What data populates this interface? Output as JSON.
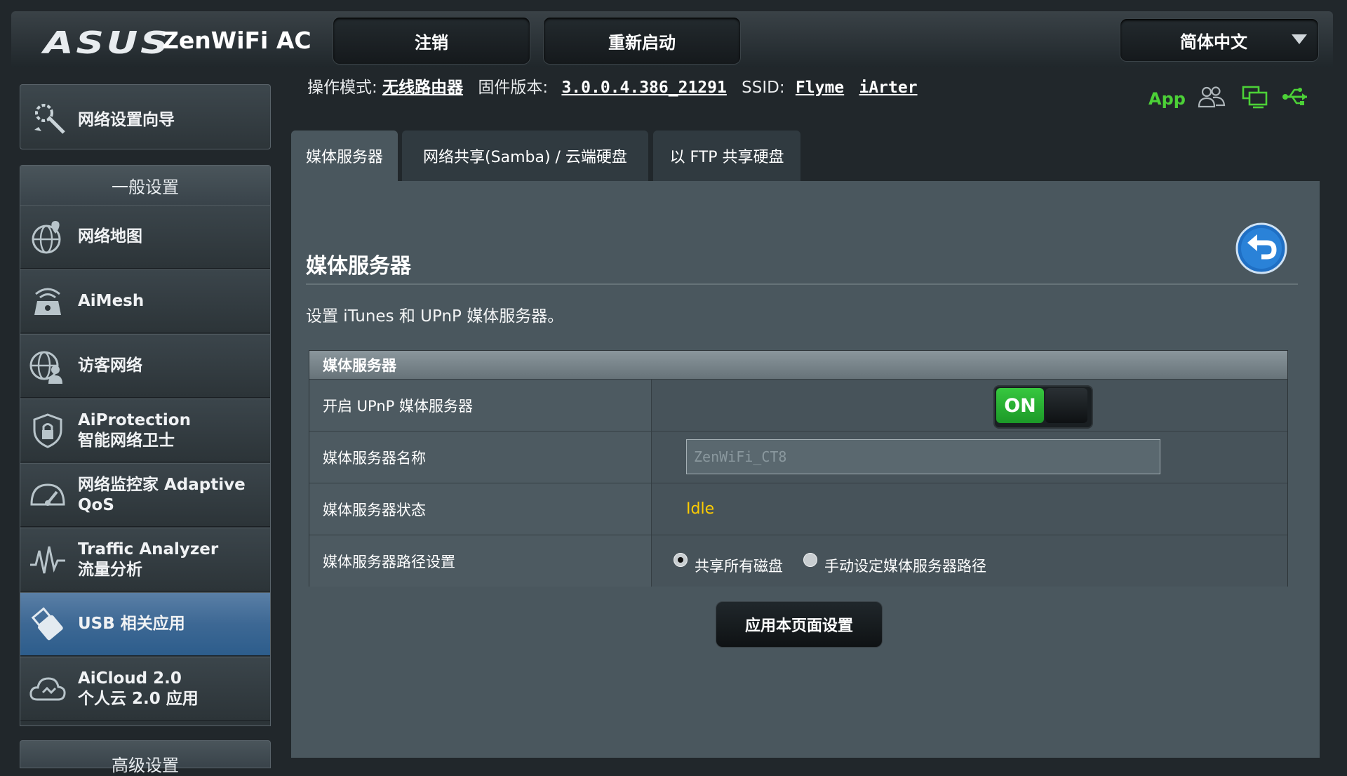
{
  "header": {
    "brand": "ASUS",
    "product": "ZenWiFi AC",
    "logout_label": "注销",
    "reboot_label": "重新启动",
    "language": "简体中文"
  },
  "status_line": {
    "opmode_label": "操作模式:",
    "opmode_value": "无线路由器",
    "firmware_label": "固件版本:",
    "firmware_value": "3.0.0.4.386_21291",
    "ssid_label": "SSID:",
    "ssid_values": [
      "Flyme",
      "iArter"
    ],
    "app_label": "App",
    "icons": [
      "clients-icon",
      "network-status-icon",
      "usb-status-icon"
    ],
    "status_color": "#4cd137"
  },
  "sidebar": {
    "wizard_label": "网络设置向导",
    "general_heading": "一般设置",
    "items": [
      {
        "icon": "globe-map-icon",
        "lines": [
          "网络地图"
        ]
      },
      {
        "icon": "aimesh-router-icon",
        "lines": [
          "AiMesh"
        ]
      },
      {
        "icon": "guest-network-icon",
        "lines": [
          "访客网络"
        ]
      },
      {
        "icon": "shield-lock-icon",
        "lines": [
          "AiProtection",
          "智能网络卫士"
        ]
      },
      {
        "icon": "speedometer-icon",
        "lines": [
          "网络监控家 Adaptive",
          "QoS"
        ]
      },
      {
        "icon": "traffic-wave-icon",
        "lines": [
          "Traffic Analyzer",
          "流量分析"
        ]
      },
      {
        "icon": "usb-icon",
        "lines": [
          "USB 相关应用"
        ],
        "active": true
      },
      {
        "icon": "cloud-icon",
        "lines": [
          "AiCloud 2.0",
          "个人云 2.0 应用"
        ]
      }
    ],
    "advanced_heading": "高级设置"
  },
  "tabs": [
    {
      "label": "媒体服务器",
      "active": true
    },
    {
      "label": "网络共享(Samba) / 云端硬盘",
      "active": false
    },
    {
      "label": "以 FTP 共享硬盘",
      "active": false
    }
  ],
  "main": {
    "title": "媒体服务器",
    "description": "设置 iTunes 和 UPnP 媒体服务器。",
    "table_heading": "媒体服务器",
    "rows": {
      "enable_label": "开启 UPnP 媒体服务器",
      "toggle_state": "ON",
      "name_label": "媒体服务器名称",
      "name_value": "ZenWiFi_CT8",
      "status_label": "媒体服务器状态",
      "status_value": "Idle",
      "status_color": "#ffcc00",
      "path_label": "媒体服务器路径设置",
      "path_options": [
        "共享所有磁盘",
        "手动设定媒体服务器路径"
      ],
      "path_selected": "共享所有磁盘"
    },
    "apply_label": "应用本页面设置"
  }
}
